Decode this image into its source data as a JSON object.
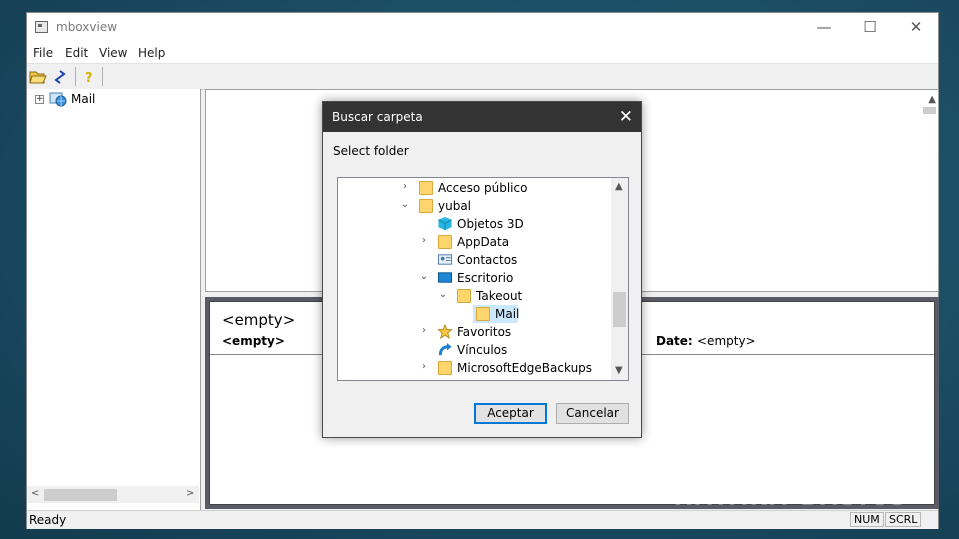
{
  "window": {
    "title": "mboxview",
    "minimize": "—",
    "maximize": "☐",
    "close": "✕"
  },
  "menu": [
    "File",
    "Edit",
    "View",
    "Help"
  ],
  "tree": {
    "root_label": "Mail",
    "expander": "+"
  },
  "preview": {
    "subject": "<empty>",
    "from": "<empty>",
    "date_label": "Date:",
    "date_value": "<empty>"
  },
  "status": {
    "text": "Ready",
    "num": "NUM",
    "scrl": "SCRL"
  },
  "watermark": "XATAKA BASICS",
  "dialog": {
    "title": "Buscar carpeta",
    "close": "✕",
    "prompt": "Select folder",
    "folders": [
      {
        "label": "Acceso público",
        "chevron": "›",
        "icon": "folder"
      },
      {
        "label": "yubal",
        "chevron": "⌄",
        "icon": "folder"
      },
      {
        "label": "Objetos 3D",
        "chevron": "",
        "icon": "cube"
      },
      {
        "label": "AppData",
        "chevron": "›",
        "icon": "folder"
      },
      {
        "label": "Contactos",
        "chevron": "",
        "icon": "contacts"
      },
      {
        "label": "Escritorio",
        "chevron": "⌄",
        "icon": "desktop"
      },
      {
        "label": "Takeout",
        "chevron": "⌄",
        "icon": "folder"
      },
      {
        "label": "Mail",
        "chevron": "",
        "icon": "folder",
        "selected": true
      },
      {
        "label": "Favoritos",
        "chevron": "›",
        "icon": "star"
      },
      {
        "label": "Vínculos",
        "chevron": "",
        "icon": "link"
      },
      {
        "label": "MicrosoftEdgeBackups",
        "chevron": "›",
        "icon": "folder"
      }
    ],
    "ok": "Aceptar",
    "cancel": "Cancelar"
  },
  "colors": {
    "selection": "#cce8ff",
    "primary_border": "#0078d7",
    "dialog_titlebar": "#333333"
  }
}
